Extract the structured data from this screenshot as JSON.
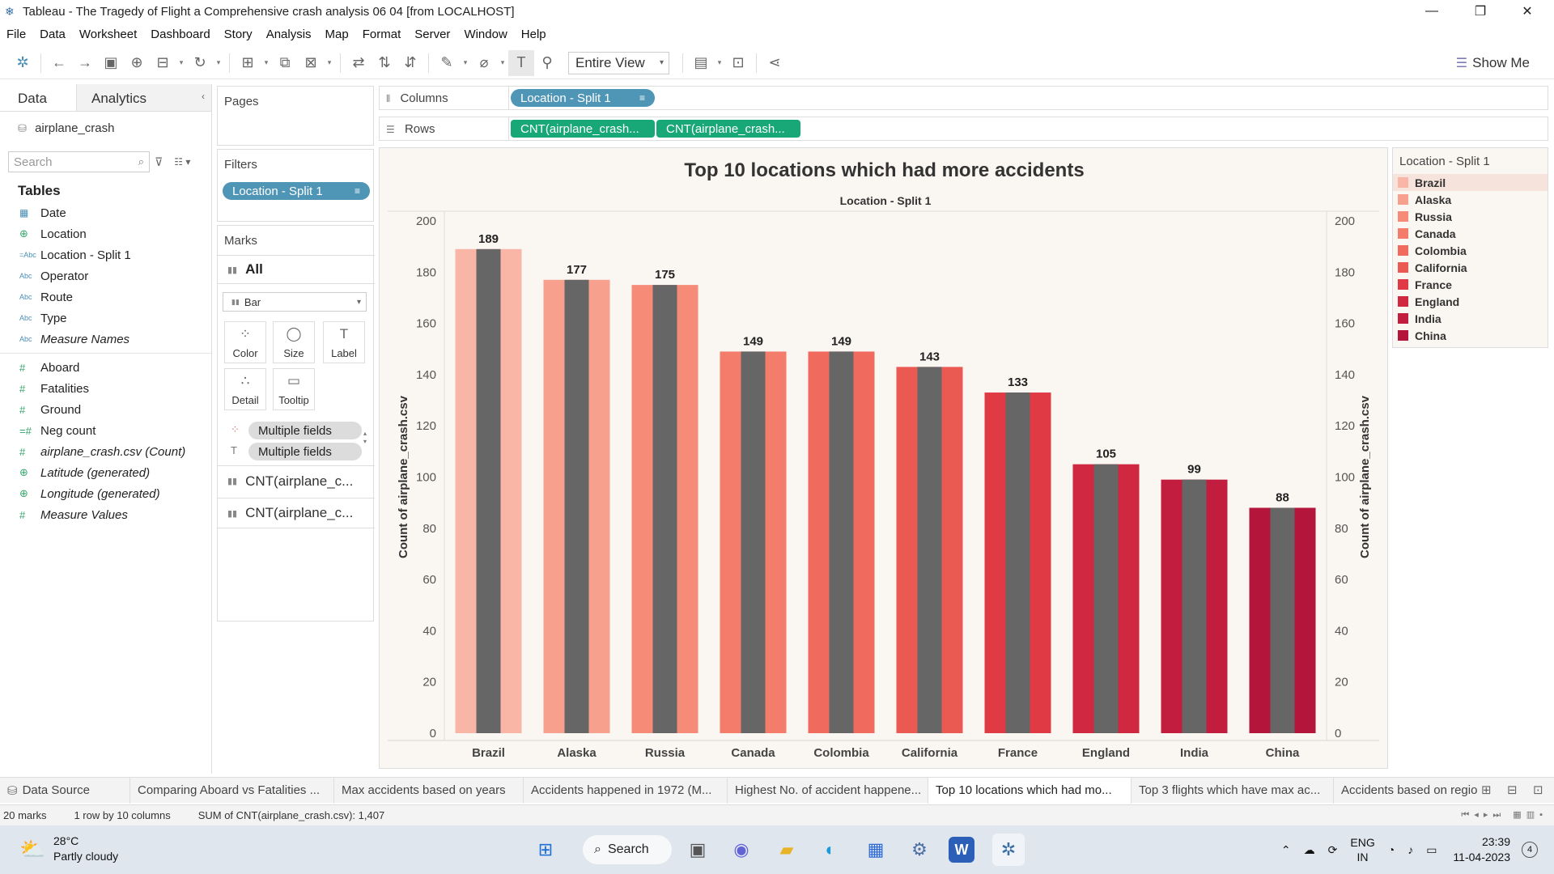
{
  "window": {
    "title": "Tableau - The Tragedy of Flight a Comprehensive crash analysis 06 04 [from LOCALHOST]",
    "minimize": "—",
    "restore": "❐",
    "close": "✕"
  },
  "menu": [
    "File",
    "Data",
    "Worksheet",
    "Dashboard",
    "Story",
    "Analysis",
    "Map",
    "Format",
    "Server",
    "Window",
    "Help"
  ],
  "toolbar": {
    "fit_mode": "Entire View",
    "show_me": "Show Me"
  },
  "data_pane": {
    "tabs": [
      "Data",
      "Analytics"
    ],
    "datasource": "airplane_crash",
    "search_placeholder": "Search",
    "tables_heading": "Tables",
    "dimensions": [
      {
        "type": "Abc",
        "icon": "calendar-icon",
        "label": "Date",
        "italic": false
      },
      {
        "type": "geo",
        "icon": "globe-icon",
        "label": "Location",
        "italic": false
      },
      {
        "type": "Abc",
        "icon": "abc-icon",
        "label": "Location - Split 1",
        "italic": false
      },
      {
        "type": "Abc",
        "icon": "abc-icon",
        "label": "Operator",
        "italic": false
      },
      {
        "type": "Abc",
        "icon": "abc-icon",
        "label": "Route",
        "italic": false
      },
      {
        "type": "Abc",
        "icon": "abc-icon",
        "label": "Type",
        "italic": false
      },
      {
        "type": "Abc",
        "icon": "abc-icon",
        "label": "Measure Names",
        "italic": true
      }
    ],
    "measures": [
      {
        "type": "#",
        "icon": "number-icon",
        "label": "Aboard",
        "italic": false
      },
      {
        "type": "#",
        "icon": "number-icon",
        "label": "Fatalities",
        "italic": false
      },
      {
        "type": "#",
        "icon": "number-icon",
        "label": "Ground",
        "italic": false
      },
      {
        "type": "#",
        "icon": "number-icon",
        "label": "Neg count",
        "italic": false
      },
      {
        "type": "#",
        "icon": "number-icon",
        "label": "airplane_crash.csv (Count)",
        "italic": true
      },
      {
        "type": "geo",
        "icon": "globe-icon",
        "label": "Latitude (generated)",
        "italic": true
      },
      {
        "type": "geo",
        "icon": "globe-icon",
        "label": "Longitude (generated)",
        "italic": true
      },
      {
        "type": "#",
        "icon": "number-icon",
        "label": "Measure Values",
        "italic": true
      }
    ]
  },
  "shelves": {
    "pages_label": "Pages",
    "filters_label": "Filters",
    "filter_pill": "Location - Split 1",
    "marks_label": "Marks",
    "marks_all": "All",
    "mark_type": "Bar",
    "mark_buttons": [
      "Color",
      "Size",
      "Label",
      "Detail",
      "Tooltip"
    ],
    "multiple_fields": [
      "Multiple fields",
      "Multiple fields"
    ],
    "cnt_rows": [
      "CNT(airplane_c...",
      "CNT(airplane_c..."
    ],
    "columns_label": "Columns",
    "columns_pill": "Location - Split 1",
    "rows_label": "Rows",
    "rows_pills": [
      "CNT(airplane_crash...",
      "CNT(airplane_crash..."
    ]
  },
  "chart_data": {
    "type": "bar",
    "title": "Top 10 locations which had more accidents",
    "header": "Location - Split 1",
    "categories": [
      "Brazil",
      "Alaska",
      "Russia",
      "Canada",
      "Colombia",
      "California",
      "France",
      "England",
      "India",
      "China"
    ],
    "values": [
      189,
      177,
      175,
      149,
      149,
      143,
      133,
      105,
      99,
      88
    ],
    "series": [
      {
        "values": [
          189,
          177,
          175,
          149,
          149,
          143,
          133,
          105,
          99,
          88
        ]
      },
      {
        "values": [
          189,
          177,
          175,
          149,
          149,
          143,
          133,
          105,
          99,
          88
        ]
      }
    ],
    "colors": [
      "#f9b5a6",
      "#f8a08e",
      "#f68b78",
      "#f47c6a",
      "#f06a5e",
      "#ea5a52",
      "#e03a45",
      "#cf2840",
      "#c21c3f",
      "#b4163b"
    ],
    "overlay_color": "#666666",
    "ylabel": "Count of airplane_crash.csv",
    "ylabel_right": "Count of airplane_crash.csv",
    "ylim": [
      0,
      200
    ],
    "yticks": [
      0,
      20,
      40,
      60,
      80,
      100,
      120,
      140,
      160,
      180,
      200
    ],
    "grid": false,
    "legend_position": "right"
  },
  "legend": {
    "title": "Location - Split 1",
    "items": [
      "Brazil",
      "Alaska",
      "Russia",
      "Canada",
      "Colombia",
      "California",
      "France",
      "England",
      "India",
      "China"
    ]
  },
  "sheet_tabs": [
    "Data Source",
    "Comparing Aboard vs Fatalities ...",
    "Max accidents based on years",
    "Accidents happened in 1972 (M...",
    "Highest No. of accident happene...",
    "Top 10 locations which had mo...",
    "Top 3 flights which have max ac...",
    "Accidents based on regio"
  ],
  "active_sheet": 5,
  "status": {
    "marks": "20 marks",
    "layout": "1 row by 10 columns",
    "sum": "SUM of CNT(airplane_crash.csv): 1,407"
  },
  "taskbar": {
    "temperature": "28°C",
    "weather": "Partly cloudy",
    "search": "Search",
    "lang": "ENG",
    "region": "IN",
    "time": "23:39",
    "date": "11-04-2023",
    "notifications": "4"
  }
}
